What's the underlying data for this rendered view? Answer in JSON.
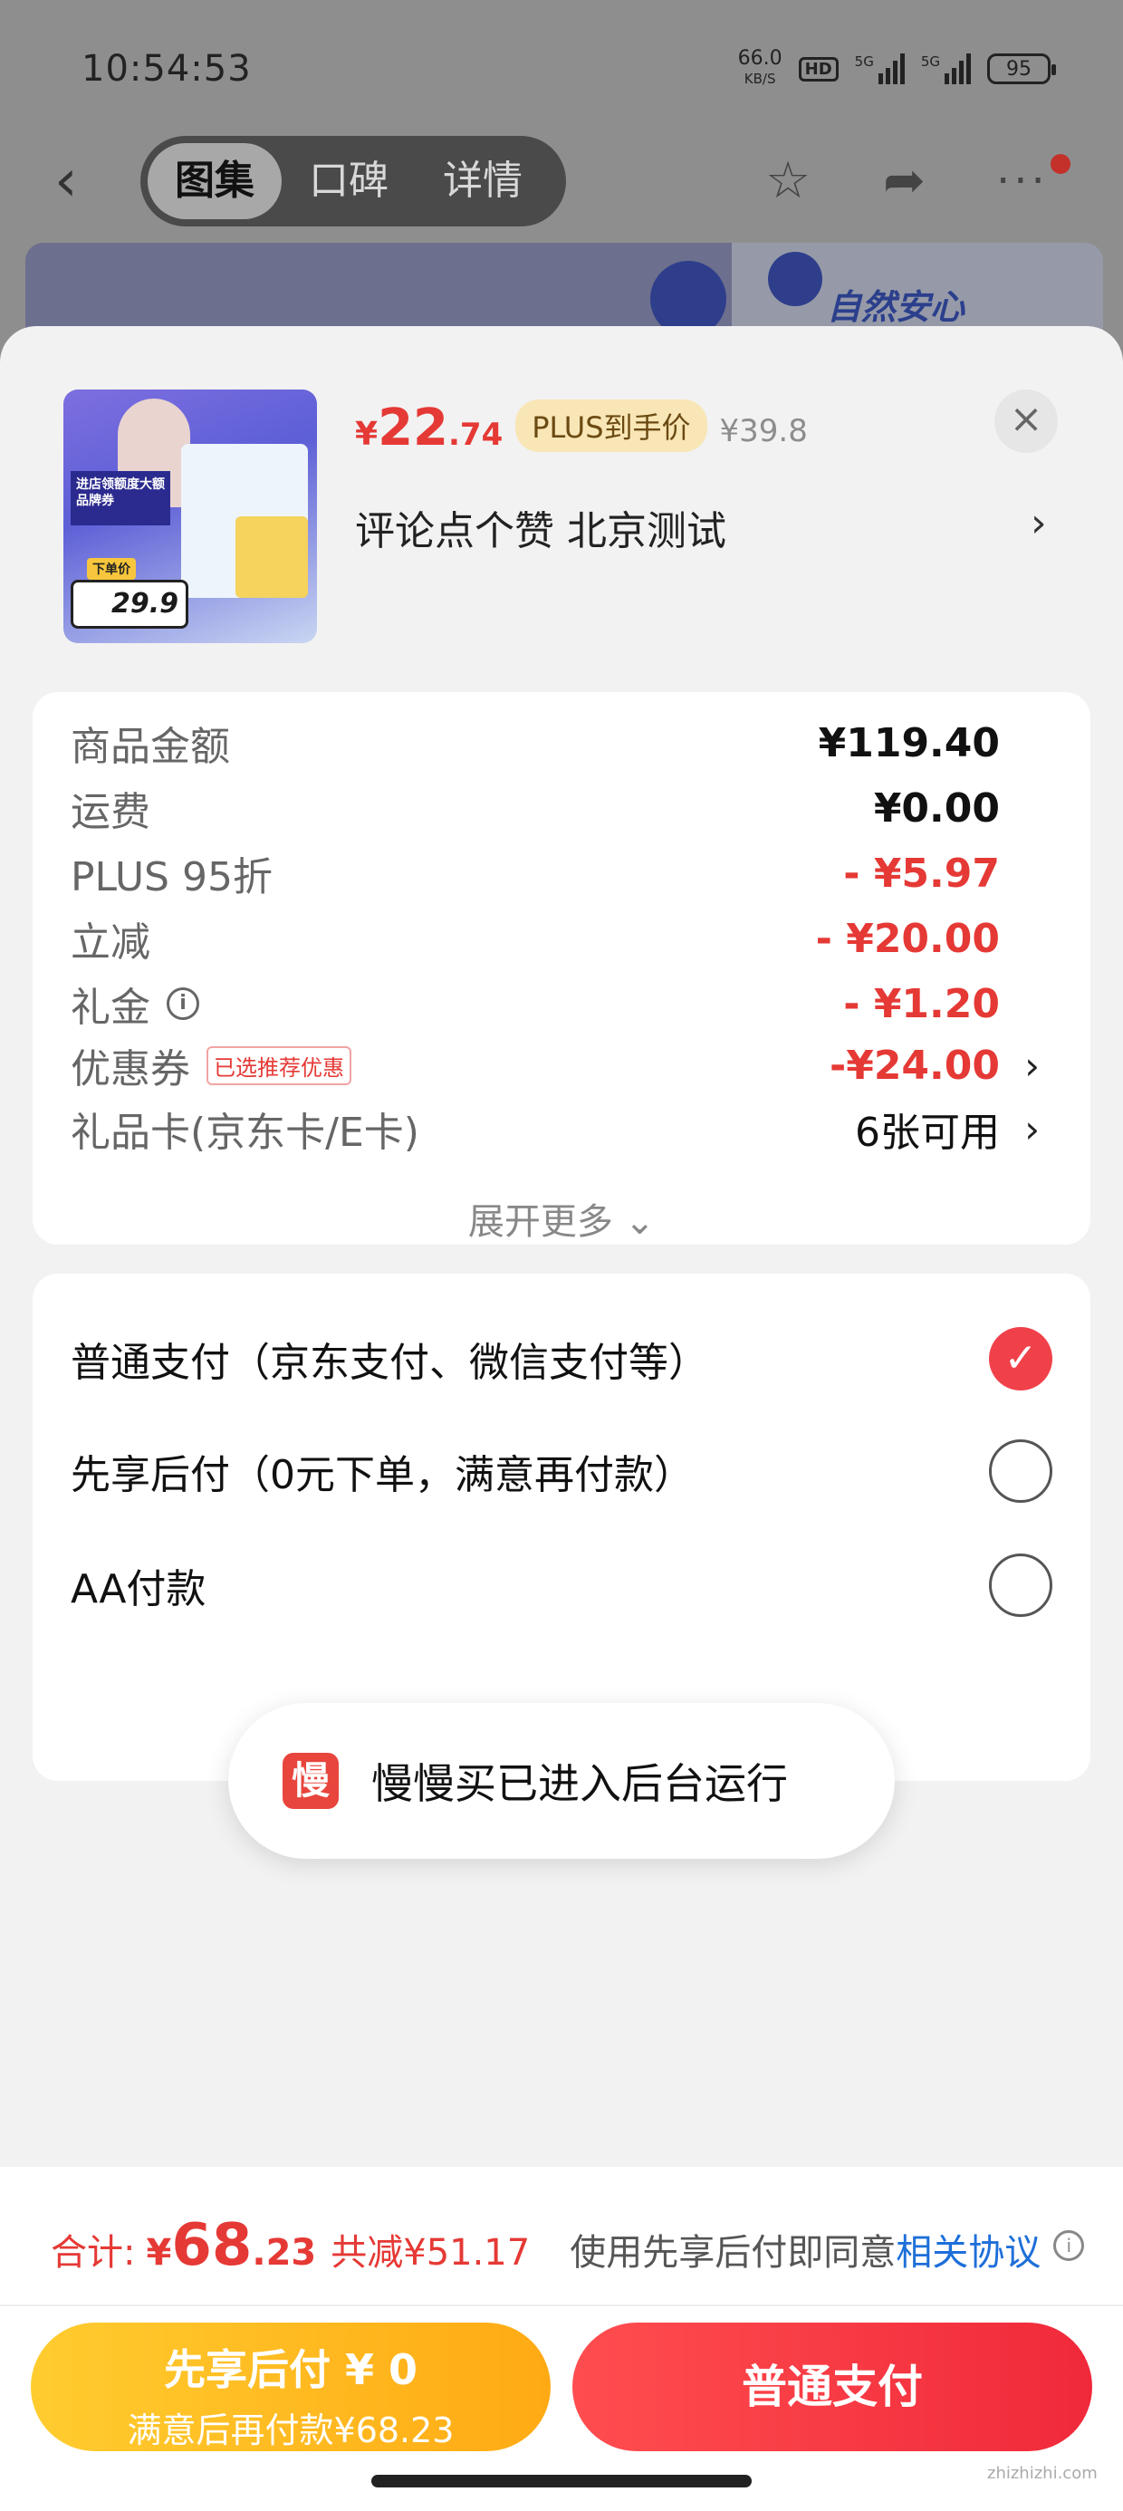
{
  "status_bar": {
    "time": "10:54:53",
    "net_speed": "66.0",
    "net_unit": "KB/S",
    "hd": "HD",
    "signal1": "5G",
    "signal2": "5G",
    "battery": "95"
  },
  "nav": {
    "tabs": [
      {
        "label": "图集",
        "active": true
      },
      {
        "label": "口碑",
        "active": false
      },
      {
        "label": "详情",
        "active": false
      }
    ],
    "back_icon": "chevron-left-icon",
    "star_icon": "star-icon",
    "share_icon": "share-icon",
    "more_icon": "more-icon"
  },
  "banner": {
    "brand_text": "自然安心"
  },
  "product": {
    "thumb_price": "29.9",
    "thumb_tag": "下单价",
    "thumb_promo": "进店领额度大额品牌券",
    "price_yen": "¥",
    "price_int": "22",
    "price_dec": ".74",
    "plus_tag": "PLUS到手价",
    "orig_price": "¥39.8",
    "title": "评论点个赞  北京测试",
    "close": "×",
    "arrow": "›"
  },
  "summary": {
    "rows": [
      {
        "label": "商品金额",
        "value": "¥119.40"
      },
      {
        "label": "运费",
        "value": "¥0.00"
      },
      {
        "label": "PLUS 95折",
        "value": "- ¥5.97"
      },
      {
        "label": "立减",
        "value": "- ¥20.00"
      },
      {
        "label": "礼金",
        "value": "- ¥1.20"
      },
      {
        "label": "优惠券",
        "tag": "已选推荐优惠",
        "value": "-¥24.00"
      },
      {
        "label": "礼品卡(京东卡/E卡)",
        "value": "6张可用"
      }
    ],
    "expand_more": "展开更多 ⌄"
  },
  "payment": {
    "options": [
      {
        "label": "普通支付（京东支付、微信支付等）",
        "checked": true
      },
      {
        "label": "先享后付（0元下单，满意再付款）",
        "checked": false
      },
      {
        "label": "AA付款",
        "checked": false
      }
    ]
  },
  "toast": {
    "icon_text": "慢",
    "text": "慢慢买已进入后台运行"
  },
  "bottom": {
    "total_label": "合计:",
    "total_yen": "¥",
    "total_int": "68",
    "total_dec": ".23",
    "saved": "共减¥51.17",
    "agree_text": "使用先享后付即同意",
    "agree_link": "相关协议",
    "btn_later_line1": "先享后付 ¥ 0",
    "btn_later_line2": "满意后再付款¥68.23",
    "btn_pay": "普通支付"
  },
  "watermark": "zhizhizhi.com",
  "colors": {
    "accent_red": "#e53935",
    "link_blue": "#1e6fd9",
    "button_yellow": "#ffbb22",
    "button_red": "#f0293a"
  }
}
